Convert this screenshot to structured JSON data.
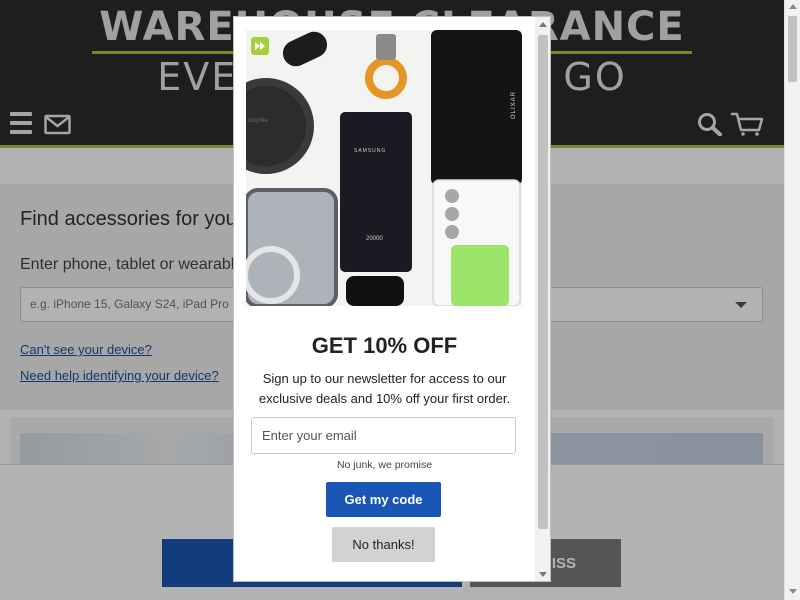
{
  "banner": {
    "line1": "WAREHOUSE CLEARANCE",
    "line2": "EVERYTHING MUST GO",
    "accent_color": "#a4c639",
    "bg_color": "#2b2b2b"
  },
  "navbar": {
    "icons": [
      "menu-icon",
      "mail-icon",
      "search-icon",
      "cart-icon"
    ]
  },
  "finder": {
    "title": "Find accessories for your device",
    "subtitle": "Enter phone, tablet or wearable",
    "select_placeholder": "e.g. iPhone 15, Galaxy S24, iPad Pro",
    "links": [
      "Can't see your device?",
      "Need help identifying your device?"
    ]
  },
  "cookie_bar": {
    "primary_label": "S",
    "dismiss_label": "ISS"
  },
  "popup": {
    "image_label_samsung": "SAMSUNG",
    "image_label_capacity": "20000",
    "image_label_mophie": "mophie",
    "image_label_olixar": "OLIXAR",
    "heading": "GET 10% OFF",
    "text": "Sign up to our newsletter for access to our exclusive deals and 10% off your first order.",
    "email_placeholder": "Enter your email",
    "email_value": "",
    "note": "No junk, we promise",
    "submit_label": "Get my code",
    "decline_label": "No thanks!",
    "primary_color": "#1a57b5"
  }
}
